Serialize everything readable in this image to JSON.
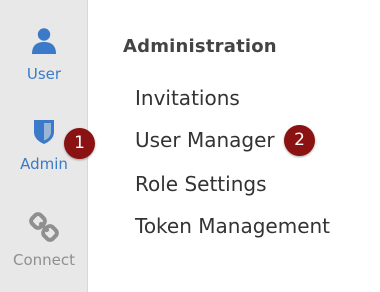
{
  "sidebar": {
    "items": [
      {
        "label": "User",
        "icon": "user-icon",
        "state": "active"
      },
      {
        "label": "Admin",
        "icon": "shield-icon",
        "state": "active"
      },
      {
        "label": "Connect",
        "icon": "link-icon",
        "state": "inactive"
      }
    ]
  },
  "main": {
    "section_title": "Administration",
    "menu": [
      {
        "label": "Invitations"
      },
      {
        "label": "User Manager"
      },
      {
        "label": "Role Settings"
      },
      {
        "label": "Token Management"
      }
    ]
  },
  "badges": [
    {
      "number": "1"
    },
    {
      "number": "2"
    }
  ],
  "colors": {
    "accent": "#3b7ac8",
    "rail_background": "#e8e8e8",
    "badge": "#8a1212",
    "inactive": "#8f8f8f"
  }
}
